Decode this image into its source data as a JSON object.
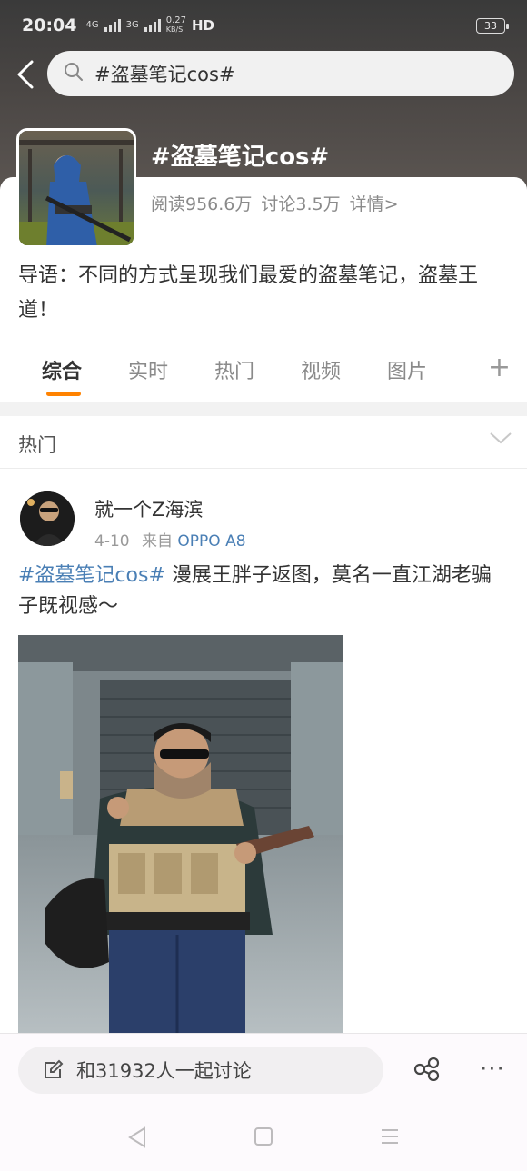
{
  "status_bar": {
    "time": "20:04",
    "net_4g": "4G",
    "net_3g": "3G",
    "speed_value": "0.27",
    "speed_unit": "KB/S",
    "hd": "HD",
    "battery": "33"
  },
  "search": {
    "query": "#盗墓笔记cos#"
  },
  "topic": {
    "title": "#盗墓笔记cos#",
    "reads": "阅读956.6万",
    "discussions": "讨论3.5万",
    "details_link": "详情>",
    "lead": "导语：不同的方式呈现我们最爱的盗墓笔记，盗墓王道！"
  },
  "tabs": [
    {
      "label": "综合",
      "active": true
    },
    {
      "label": "实时",
      "active": false
    },
    {
      "label": "热门",
      "active": false
    },
    {
      "label": "视频",
      "active": false
    },
    {
      "label": "图片",
      "active": false
    }
  ],
  "tab_add": "+",
  "section": {
    "title": "热门"
  },
  "post": {
    "author": "就一个Z海滨",
    "date": "4-10",
    "source_prefix": "来自",
    "device": "OPPO A8",
    "hashtag": "#盗墓笔记cos#",
    "text": " 漫展王胖子返图，莫名一直江湖老骗子既视感～"
  },
  "bottom_bar": {
    "discuss_label": "和31932人一起讨论",
    "more_label": "···"
  },
  "icons": {
    "back": "back-arrow-icon",
    "search": "search-icon",
    "chevron": "chevron-down-icon",
    "edit": "edit-icon",
    "share": "share-icon",
    "more": "more-icon"
  },
  "colors": {
    "accent": "#ff8200",
    "link": "#4a7fb5"
  }
}
